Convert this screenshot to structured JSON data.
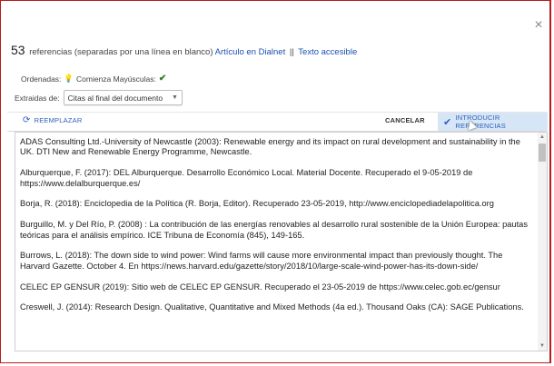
{
  "dialog": {
    "close_glyph": "×"
  },
  "header": {
    "count": "53",
    "text": "referencias (separadas por una línea en blanco)",
    "link_dialnet": "Artículo en Dialnet",
    "separator": "||",
    "link_accessible": "Texto accesible"
  },
  "options": {
    "ordered_label": "Ordenadas:",
    "caps_label": "Comienza Mayúsculas:",
    "extracted_label": "Extraidas de:",
    "extracted_value": "Citas al final del documento"
  },
  "toolbar": {
    "replace_label": "REEMPLAZAR",
    "cancel_label": "CANCELAR",
    "introduce_label": "INTRODUCIR REFERENCIAS"
  },
  "references": [
    "ADAS Consulting Ltd.-University of Newcastle (2003): Renewable energy and its impact on rural development and sustainability in the UK. DTI New and Renewable Energy Programme, Newcastle.",
    "Alburquerque, F. (2017): DEL Alburquerque. Desarrollo Económico Local. Material Docente. Recuperado el 9-05-2019 de https://www.delalburquerque.es/",
    "Borja, R. (2018): Enciclopedia de la Política (R. Borja, Editor). Recuperado 23-05-2019, http://www.enciclopediadelapolitica.org",
    "Burguillo, M. y Del Río, P. (2008) : La contribución de las energías renovables al desarrollo rural sostenible de la Unión Europea: pautas teóricas para el análisis empírico. ICE Tribuna de Economía (845), 149-165.",
    "Burrows, L. (2018): The down side to wind power: Wind farms will cause more environmental impact than previously thought. The Harvard Gazette. October 4. En https://news.harvard.edu/gazette/story/2018/10/large-scale-wind-power-has-its-down-side/",
    "CELEC EP GENSUR (2019): Sitio web de CELEC EP GENSUR. Recuperado el 23-05-2019 de https://www.celec.gob.ec/gensur",
    "Creswell, J. (2014): Research Design. Qualitative, Quantitative and Mixed Methods (4a ed.). Thousand Oaks (CA): SAGE Publications."
  ]
}
